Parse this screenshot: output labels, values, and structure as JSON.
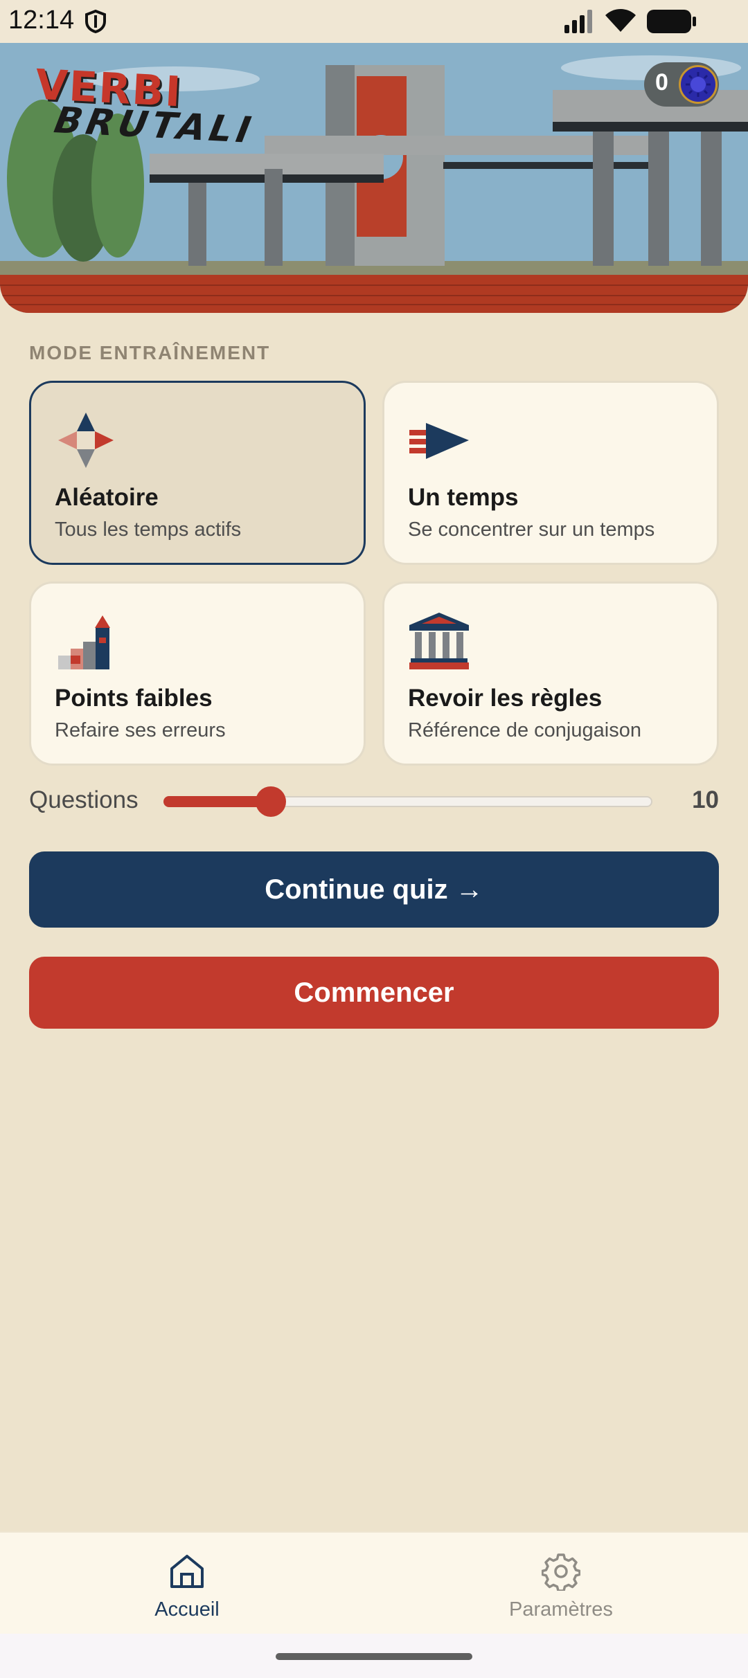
{
  "status_bar": {
    "time": "12:14"
  },
  "header": {
    "logo_line1": "VERBI",
    "logo_line2": "BRUTALI",
    "coins": "0"
  },
  "section": {
    "label": "MODE ENTRAÎNEMENT"
  },
  "modes": [
    {
      "title": "Aléatoire",
      "subtitle": "Tous les temps actifs",
      "icon": "compass-icon",
      "selected": true
    },
    {
      "title": "Un temps",
      "subtitle": "Se concentrer sur un temps",
      "icon": "arrow-flag-icon",
      "selected": false
    },
    {
      "title": "Points faibles",
      "subtitle": "Refaire ses erreurs",
      "icon": "stairs-tower-icon",
      "selected": false
    },
    {
      "title": "Revoir les règles",
      "subtitle": "Référence de conjugaison",
      "icon": "temple-icon",
      "selected": false
    }
  ],
  "questions": {
    "label": "Questions",
    "value": "10",
    "fill_fraction": 0.22
  },
  "buttons": {
    "continue": "Continue quiz →",
    "start": "Commencer"
  },
  "nav": {
    "home": "Accueil",
    "settings": "Paramètres",
    "active": "home"
  },
  "colors": {
    "primary": "#1c3a5d",
    "accent": "#c23a2d",
    "background": "#ede3cc",
    "card": "#fcf7ea"
  }
}
